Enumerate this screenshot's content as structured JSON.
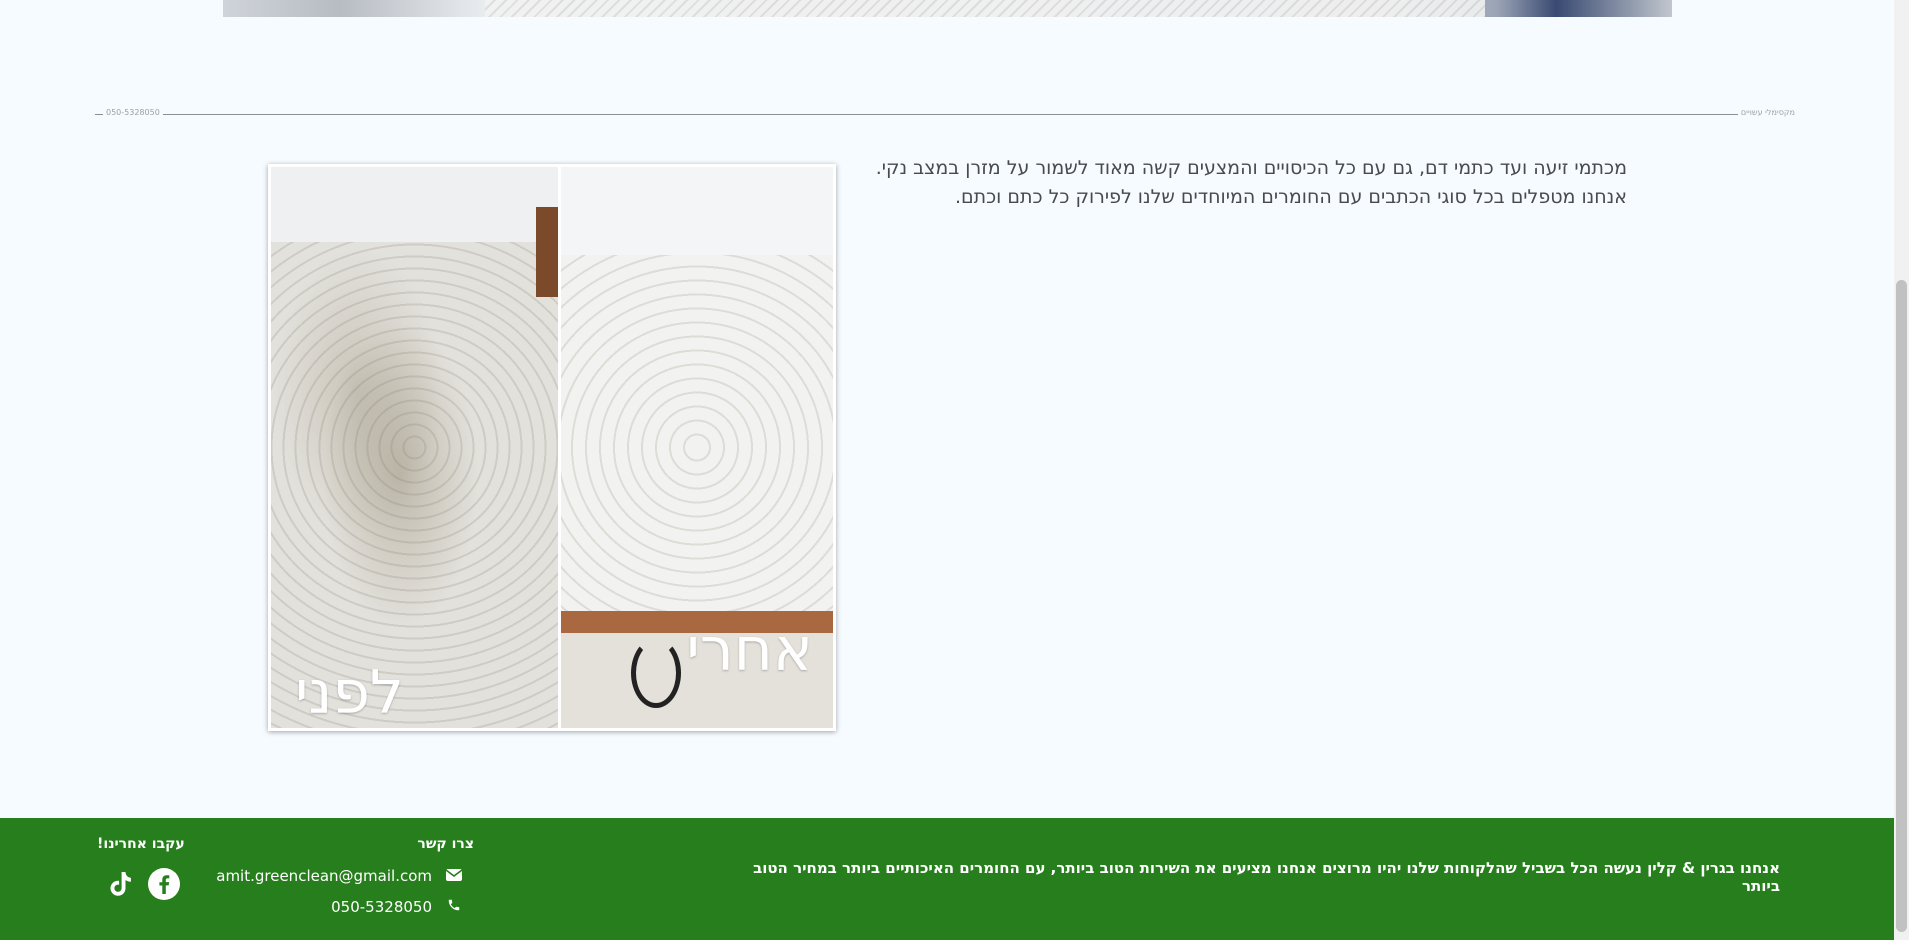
{
  "divider": {
    "left_text": "050-5328050",
    "right_text": "מקסימלי עשויים"
  },
  "content": {
    "line1": "מכתמי זיעה ועד כתמי דם, גם עם כל הכיסויים והמצעים קשה מאוד לשמור על מזרן במצב נקי.",
    "line2": "אנחנו מטפלים בכל סוגי הכתבים עם החומרים המיוחדים שלנו לפירוק כל כתם וכתם."
  },
  "photo": {
    "before_label": "לפני",
    "after_label": "אחרי"
  },
  "footer": {
    "about": "אנחנו בגרין & קלין נעשה הכל בשביל שהלקוחות שלנו יהיו מרוצים אנחנו מציעים את השירות הטוב ביותר, עם החומרים האיכותיים ביותר במחיר הטוב ביותר",
    "contact_title": "צרו קשר",
    "email": "amit.greenclean@gmail.com",
    "phone": "050-5328050",
    "follow_title": "עקבו אחרינו!"
  },
  "icons": {
    "email": "envelope-icon",
    "phone": "phone-icon",
    "facebook": "facebook-icon",
    "tiktok": "tiktok-icon"
  },
  "colors": {
    "background": "#f6fbff",
    "footer": "#267e1c",
    "text": "#474a4e"
  }
}
